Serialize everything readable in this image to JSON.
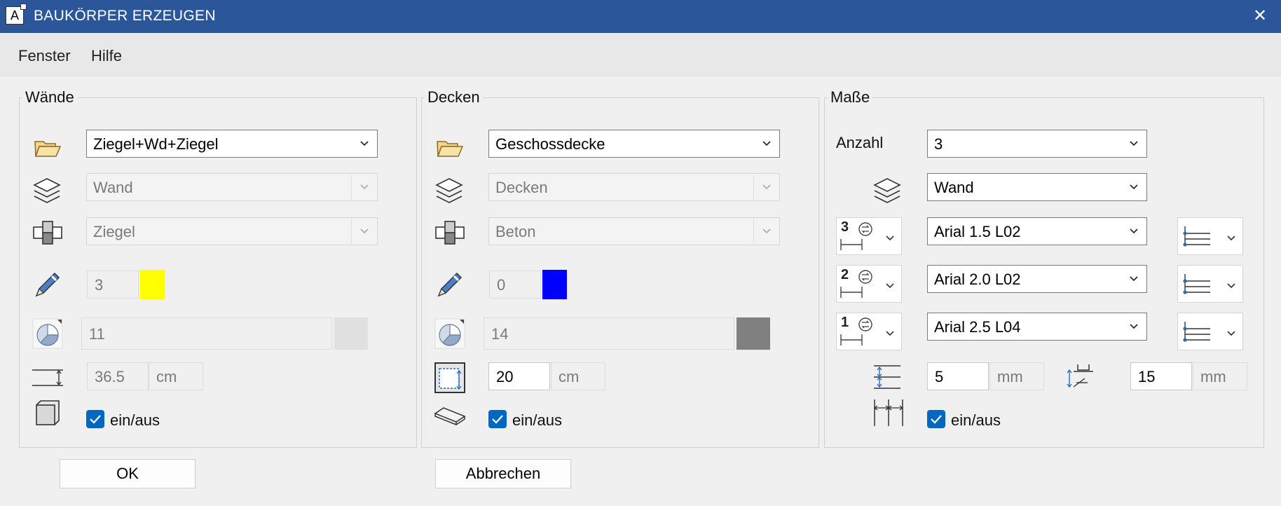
{
  "window": {
    "title": "BAUKÖRPER ERZEUGEN",
    "close_glyph": "✕",
    "app_icon_letter": "A"
  },
  "menu": {
    "items": [
      "Fenster",
      "Hilfe"
    ]
  },
  "walls": {
    "title": "Wände",
    "style_value": "Ziegel+Wd+Ziegel",
    "layer_value": "Wand",
    "material_value": "Ziegel",
    "pen_value": "3",
    "pen_color": "#ffff00",
    "fill_value": "11",
    "fill_color": "#e0e0e0",
    "thickness_value": "36.5",
    "thickness_unit": "cm",
    "toggle_label": "ein/aus",
    "toggle_checked": true
  },
  "ceilings": {
    "title": "Decken",
    "style_value": "Geschossdecke",
    "layer_value": "Decken",
    "material_value": "Beton",
    "pen_value": "0",
    "pen_color": "#0000ff",
    "fill_value": "14",
    "fill_color": "#808080",
    "thickness_value": "20",
    "thickness_unit": "cm",
    "toggle_label": "ein/aus",
    "toggle_checked": true
  },
  "dimensions": {
    "title": "Maße",
    "count_label": "Anzahl",
    "count_value": "3",
    "layer_value": "Wand",
    "rows": [
      {
        "level": "3",
        "font": "Arial 1.5 L02"
      },
      {
        "level": "2",
        "font": "Arial 2.0 L02"
      },
      {
        "level": "1",
        "font": "Arial 2.5 L04"
      }
    ],
    "spacing_value": "5",
    "spacing_unit": "mm",
    "offset_value": "15",
    "offset_unit": "mm",
    "toggle_label": "ein/aus",
    "toggle_checked": true
  },
  "buttons": {
    "ok": "OK",
    "cancel": "Abbrechen"
  },
  "colors": {
    "titlebar": "#2b579a",
    "accent": "#0067c0"
  }
}
